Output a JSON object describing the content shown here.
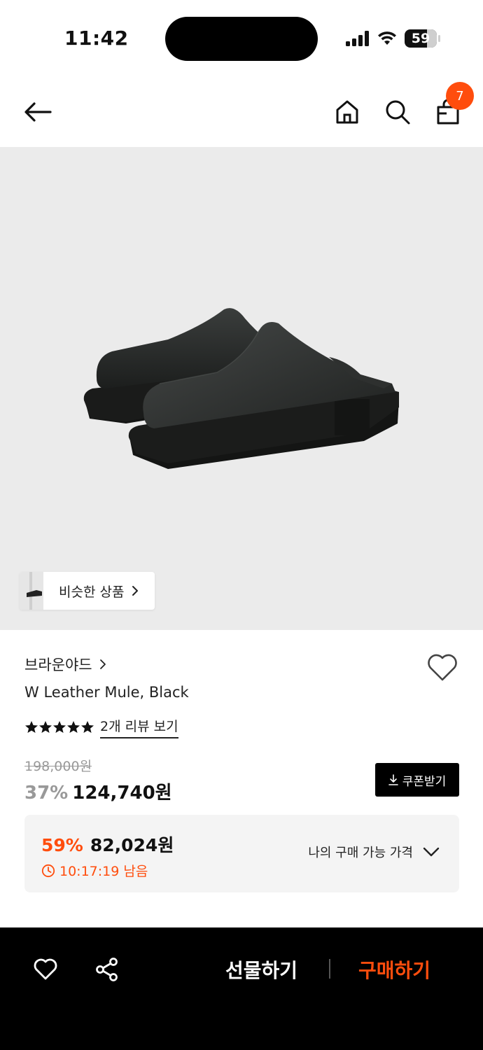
{
  "status_bar": {
    "time": "11:42",
    "battery": "59"
  },
  "header": {
    "cart_count": "7",
    "icons": [
      "back-arrow-icon",
      "home-icon",
      "search-icon",
      "shopping-bag-icon"
    ]
  },
  "gallery": {
    "similar_label": "비슷한 상품"
  },
  "product": {
    "brand": "브라운야드",
    "name": "W Leather Mule, Black",
    "rating_stars": 5,
    "review_link": "2개 리뷰 보기",
    "original_price": "198,000원",
    "discount_rate": "37%",
    "sale_price": "124,740원",
    "coupon_label": "쿠폰받기"
  },
  "best_price": {
    "rate": "59%",
    "price": "82,024원",
    "timer": "10:17:19 남음",
    "my_price_label": "나의 구매 가능 가격"
  },
  "bottom_bar": {
    "gift_label": "선물하기",
    "buy_label": "구매하기"
  },
  "colors": {
    "accent": "#ff4d0d",
    "image_bg": "#ebebeb",
    "bottom_bar_bg": "#000000",
    "best_price_bg": "#f4f4f4"
  }
}
